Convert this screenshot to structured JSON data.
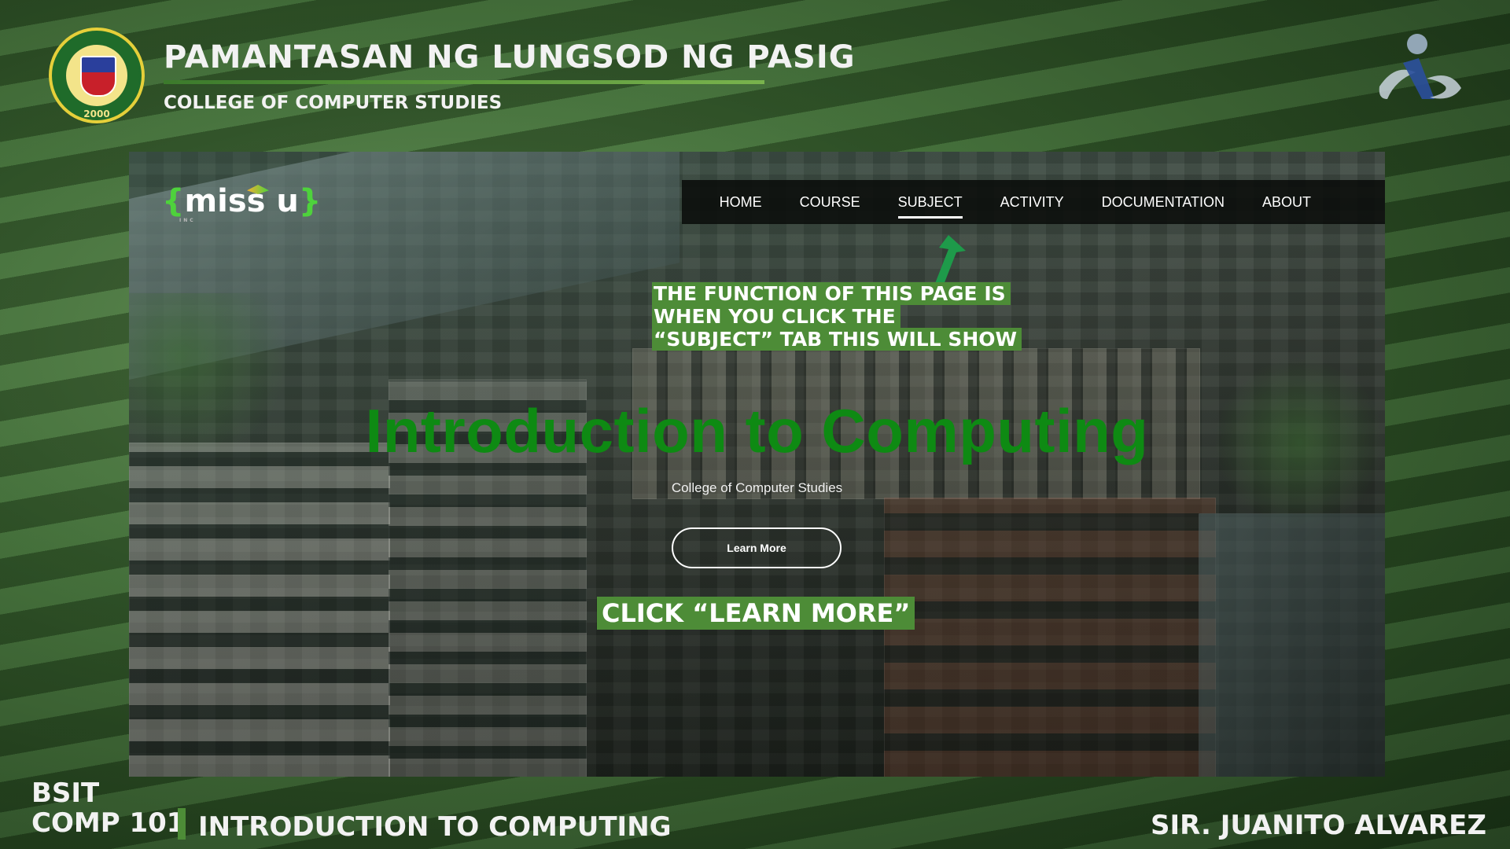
{
  "header": {
    "university": "PAMANTASAN NG LUNGSOD NG PASIG",
    "college": "COLLEGE OF COMPUTER STUDIES",
    "seal_year": "2000"
  },
  "site": {
    "logo_text": "miss u",
    "logo_sub": "INC",
    "nav": [
      "HOME",
      "COURSE",
      "SUBJECT",
      "ACTIVITY",
      "DOCUMENTATION",
      "ABOUT"
    ],
    "active_nav": "SUBJECT",
    "annotation_lines": [
      "THE FUNCTION OF THIS PAGE IS",
      "WHEN YOU CLICK THE",
      "“SUBJECT” TAB THIS WILL SHOW"
    ],
    "hero_title": "Introduction to Computing",
    "hero_subtitle": "College of Computer Studies",
    "button_label": "Learn More",
    "click_note": "CLICK “LEARN MORE”"
  },
  "footer": {
    "program": "BSIT",
    "course_code": "COMP 101",
    "course_title": "INTRODUCTION TO COMPUTING",
    "instructor": "SIR. JUANITO ALVAREZ"
  },
  "colors": {
    "accent_green": "#4d8c37",
    "hero_green": "#0e8a13",
    "logo_green": "#4ed23c"
  },
  "icons": [
    "plp-seal-icon",
    "ccs-logo-icon",
    "arrow-up-icon"
  ]
}
